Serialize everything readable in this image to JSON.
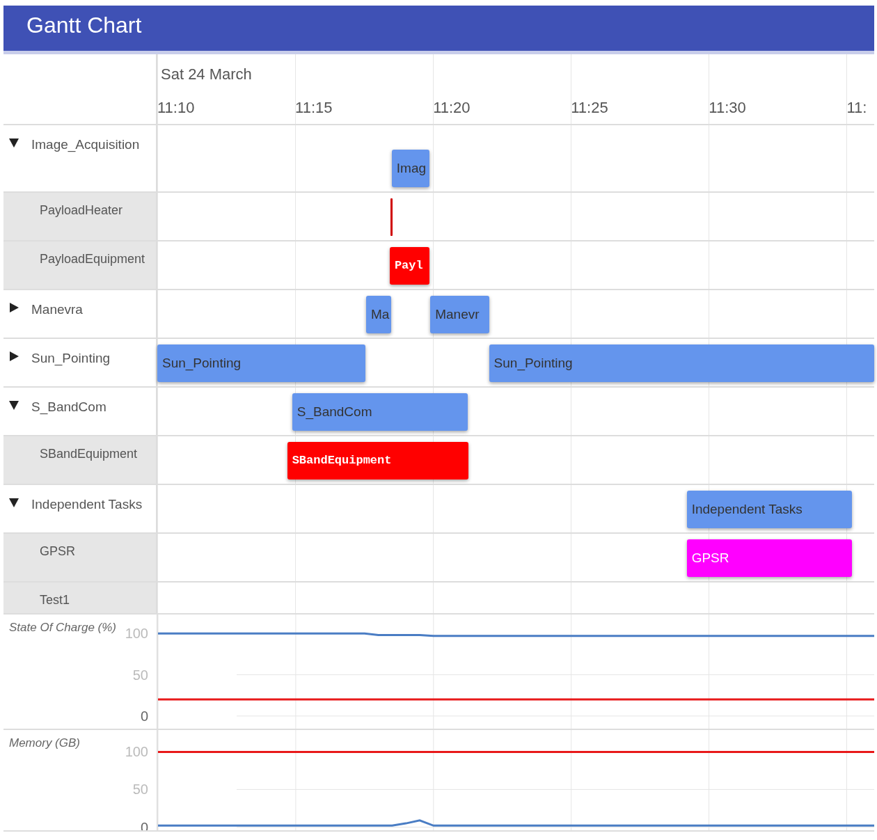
{
  "header": {
    "title": "Gantt Chart"
  },
  "timeline": {
    "date": "Sat 24 March",
    "ticks": [
      {
        "label": "11:10"
      },
      {
        "label": "11:15"
      },
      {
        "label": "11:20"
      },
      {
        "label": "11:25"
      },
      {
        "label": "11:30"
      },
      {
        "label": "11:"
      }
    ]
  },
  "rows": [
    {
      "label": "Image_Acquisition",
      "expanded": true,
      "bars": [
        {
          "label": "Imag",
          "kind": "task",
          "color": "#6495ed"
        }
      ],
      "children": [
        {
          "label": "PayloadHeater",
          "bars": [
            {
              "kind": "marker",
              "color": "#d00000"
            }
          ]
        },
        {
          "label": "PayloadEquipment",
          "bars": [
            {
              "label": "Payl",
              "kind": "equipment",
              "color": "#ff0000"
            }
          ]
        }
      ]
    },
    {
      "label": "Manevra",
      "expanded": false,
      "bars": [
        {
          "label": "Ma",
          "kind": "task",
          "color": "#6495ed"
        },
        {
          "label": "Manevr",
          "kind": "task",
          "color": "#6495ed"
        }
      ]
    },
    {
      "label": "Sun_Pointing",
      "expanded": false,
      "bars": [
        {
          "label": "Sun_Pointing",
          "kind": "task",
          "color": "#6495ed"
        },
        {
          "label": "Sun_Pointing",
          "kind": "task",
          "color": "#6495ed"
        }
      ]
    },
    {
      "label": "S_BandCom",
      "expanded": true,
      "bars": [
        {
          "label": "S_BandCom",
          "kind": "task",
          "color": "#6495ed"
        }
      ],
      "children": [
        {
          "label": "SBandEquipment",
          "bars": [
            {
              "label": "SBandEquipment",
              "kind": "equipment",
              "color": "#ff0000"
            }
          ]
        }
      ]
    },
    {
      "label": "Independent Tasks",
      "expanded": true,
      "bars": [
        {
          "label": "Independent Tasks",
          "kind": "task",
          "color": "#6495ed"
        }
      ],
      "children": [
        {
          "label": "GPSR",
          "bars": [
            {
              "label": "GPSR",
              "kind": "custom",
              "color": "#ff00ff"
            }
          ]
        },
        {
          "label": "Test1"
        }
      ]
    }
  ],
  "charts": [
    {
      "chart_data": {
        "type": "line",
        "title": "State Of Charge (%)",
        "yticks": [
          0,
          50,
          100
        ],
        "ylim": [
          -17,
          123
        ],
        "grid": true,
        "categories": [
          null,
          null,
          null,
          null,
          null,
          null,
          null,
          null,
          null,
          null,
          null,
          null,
          null,
          null,
          null,
          null,
          null,
          null,
          null,
          null,
          null,
          null,
          null,
          null,
          null,
          null,
          null,
          null,
          null,
          null,
          null,
          null,
          null,
          null,
          null,
          null,
          null,
          null,
          null,
          null,
          null,
          null,
          null,
          null,
          null,
          null,
          null,
          null,
          null,
          null,
          null,
          null,
          null
        ],
        "series": [
          {
            "color": "#4a7dc4",
            "values": [
              100,
              100,
              100,
              100,
              100,
              100,
              100,
              100,
              100,
              100,
              100,
              100,
              100,
              100,
              100,
              100,
              98,
              98,
              98,
              98,
              97,
              97,
              97,
              97,
              97,
              97,
              97,
              97,
              97,
              97,
              97,
              97,
              97,
              97,
              97,
              97,
              97,
              97,
              97,
              97,
              97,
              97,
              97,
              97,
              97,
              97,
              97,
              97,
              97,
              97,
              97,
              97,
              97
            ]
          },
          {
            "color": "#e8191a",
            "values": [
              20,
              20,
              20,
              20,
              20,
              20,
              20,
              20,
              20,
              20,
              20,
              20,
              20,
              20,
              20,
              20,
              20,
              20,
              20,
              20,
              20,
              20,
              20,
              20,
              20,
              20,
              20,
              20,
              20,
              20,
              20,
              20,
              20,
              20,
              20,
              20,
              20,
              20,
              20,
              20,
              20,
              20,
              20,
              20,
              20,
              20,
              20,
              20,
              20,
              20,
              20,
              20,
              20
            ]
          }
        ]
      }
    },
    {
      "chart_data": {
        "type": "line",
        "title": "Memory (GB)",
        "yticks": [
          0,
          50,
          100
        ],
        "ylim": [
          -6,
          129
        ],
        "grid": true,
        "categories": [
          null,
          null,
          null,
          null,
          null,
          null,
          null,
          null,
          null,
          null,
          null,
          null,
          null,
          null,
          null,
          null,
          null,
          null,
          null,
          null,
          null,
          null,
          null,
          null,
          null,
          null,
          null,
          null,
          null,
          null,
          null,
          null,
          null,
          null,
          null,
          null,
          null,
          null,
          null,
          null,
          null,
          null,
          null,
          null,
          null,
          null,
          null,
          null,
          null,
          null,
          null,
          null,
          null
        ],
        "series": [
          {
            "color": "#4a7dc4",
            "values": [
              2,
              2,
              2,
              2,
              2,
              2,
              2,
              2,
              2,
              2,
              2,
              2,
              2,
              2,
              2,
              2,
              2,
              2,
              5,
              9,
              2,
              2,
              2,
              2,
              2,
              2,
              2,
              2,
              2,
              2,
              2,
              2,
              2,
              2,
              2,
              2,
              2,
              2,
              2,
              2,
              2,
              2,
              2,
              2,
              2,
              2,
              2,
              2,
              2,
              2,
              2,
              2,
              2
            ]
          },
          {
            "color": "#e8191a",
            "values": [
              100,
              100,
              100,
              100,
              100,
              100,
              100,
              100,
              100,
              100,
              100,
              100,
              100,
              100,
              100,
              100,
              100,
              100,
              100,
              100,
              100,
              100,
              100,
              100,
              100,
              100,
              100,
              100,
              100,
              100,
              100,
              100,
              100,
              100,
              100,
              100,
              100,
              100,
              100,
              100,
              100,
              100,
              100,
              100,
              100,
              100,
              100,
              100,
              100,
              100,
              100,
              100,
              100
            ]
          }
        ]
      }
    }
  ]
}
